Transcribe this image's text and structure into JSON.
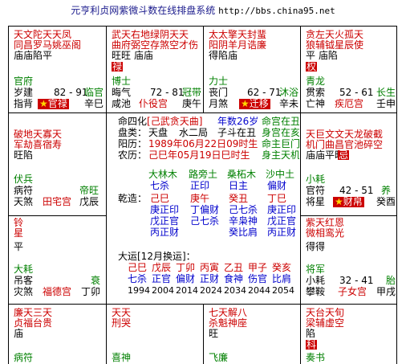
{
  "title": {
    "text": "元亨利贞网紫微斗数在线排盘系统",
    "url": "http://bbs.china95.net"
  },
  "palaces": {
    "p1": {
      "stars1": "天文陀天天凤",
      "stars2": "同昌罗马姚巫阁",
      "stars3": "庙庙陷平",
      "gods1": "官府",
      "gods2": "岁建",
      "gods3": "指背",
      "age": "82 - 91",
      "name": "官禄",
      "stage": "临官",
      "stem": "辛巳"
    },
    "p2": {
      "stars1": "武天右地绿阴天天",
      "stars2": "曲府弼空存煞空才伤",
      "stars3": "旺旺    庙庙",
      "tag": "禄",
      "gods1": "博士",
      "gods2": "晦气",
      "gods3": "咸池",
      "age": "72 - 81",
      "name": "仆役宫",
      "stage": "冠带",
      "stem": "庚午"
    },
    "p3": {
      "stars1": "太太擎天封蜚",
      "stars2": "阳阴羊月诰廉",
      "stars3": "得陷庙",
      "gods1": "力士",
      "gods2": "丧门",
      "gods3": "月煞",
      "age": "62 - 71",
      "name": "迁移",
      "stage": "沐浴",
      "stem": "辛未"
    },
    "p4": {
      "stars1": "贪左天火孤天",
      "stars2": "狼辅钺星辰使",
      "stars3": "平    庙陷",
      "tag": "权",
      "gods1": "青龙",
      "gods2": "贯索",
      "gods3": "亡神",
      "age": "52 - 61",
      "name": "疾厄宫",
      "stage": "长生",
      "stem": "壬申"
    },
    "p5": {
      "stars1": "破地天寡天",
      "stars2": "军劫喜宿寿",
      "stars3": "旺陷",
      "gods1": "伏兵",
      "gods2": "病符",
      "gods3": "天煞",
      "name": "田宅宫",
      "stage": "帝旺",
      "stem": "戊辰"
    },
    "p6": {
      "stars1": "天巨文文天龙破截",
      "stars2": "机门曲昌官池碎空",
      "stars3": "庙庙平旺",
      "tag": "忌",
      "gods1": "小耗",
      "gods2": "官符",
      "gods3": "将星",
      "age": "42 - 51",
      "name": "财帛",
      "stage": "养",
      "stem": "癸酉"
    },
    "p7": {
      "stars1": "铃",
      "stars2": "星",
      "stars3": "平",
      "gods1": "大耗",
      "gods2": "吊客",
      "gods3": "灾煞",
      "name": "福德宫",
      "stage": "衰",
      "stem": "丁卯"
    },
    "p8": {
      "stars1": "紫天红恩",
      "stars2": "微相鸾光",
      "stars3": "得得",
      "gods1": "将军",
      "gods2": "小耗",
      "gods3": "攀鞍",
      "age": "32 - 41",
      "name": "子女宫",
      "stage": "胎",
      "stem": "甲戌"
    },
    "p9": {
      "stars1": "廉天三天",
      "stars2": "贞福台贵",
      "stars3": "庙",
      "gods1": "病符",
      "gods2": "",
      "gods3": ""
    },
    "p10": {
      "stars1": "天天",
      "stars2": "刑哭",
      "stars3": "",
      "gods1": "喜神",
      "gods2": "",
      "gods3": ""
    },
    "p11": {
      "stars1": "七天解八",
      "stars2": "杀魁神座",
      "stars3": "旺",
      "gods1": "飞廉",
      "gods2": "",
      "gods3": ""
    },
    "p12": {
      "stars1": "天台天旬",
      "stars2": "梁辅虚空",
      "stars3": "陷",
      "tag": "科",
      "gods1": "奏书",
      "gods2": "",
      "gods3": ""
    }
  },
  "center": {
    "line1a": "命四化",
    "line1b": "[己武贪天曲]",
    "line1c": "年数26岁",
    "line1d": "命宫在丑",
    "line2a": "盘类：",
    "line2b": "天盘",
    "line2c": "水二局",
    "line2d": "子斗在丑",
    "line2e": "身宫在亥",
    "line3a": "阳历：",
    "line3b": "1989年06月22日09时生",
    "line3c": "命主巨门",
    "line4a": "农历：",
    "line4b": "己巳年05月19日巳时生",
    "line4c": "身主天机",
    "bazi_top": [
      "大林木",
      "路旁土",
      "桑柘木",
      "沙中土"
    ],
    "bazi_top2": [
      "七杀",
      "正印",
      "日主",
      "偏财"
    ],
    "bazi_label": "乾造：",
    "bazi_stems": [
      "己巳",
      "庚午",
      "癸丑",
      "丁巳"
    ],
    "bazi_h1": [
      "庚正印",
      "丁偏财",
      "己七杀",
      "庚正印"
    ],
    "bazi_h2": [
      "戊正官",
      "己七杀",
      "辛枭神",
      "戊正官"
    ],
    "bazi_h3": [
      "丙正财",
      "",
      "癸比肩",
      "丙正财"
    ],
    "dayun_label": "大运[12月换运]：",
    "dayun_stems": [
      "己巳",
      "戊辰",
      "丁卯",
      "丙寅",
      "乙丑",
      "甲子",
      "癸亥"
    ],
    "dayun_gods": [
      "七杀",
      "正官",
      "偏财",
      "正财",
      "食神",
      "伤官",
      "比肩"
    ],
    "dayun_years": [
      "1994",
      "2004",
      "2014",
      "2024",
      "2034",
      "2044",
      "2054"
    ]
  }
}
